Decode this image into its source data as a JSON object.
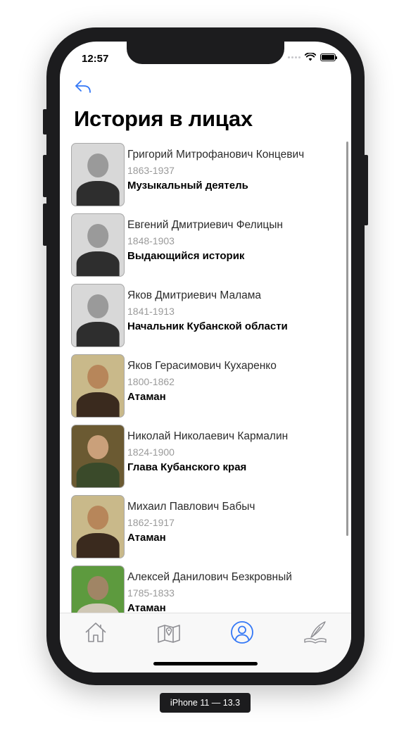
{
  "status_bar": {
    "time": "12:57"
  },
  "header": {
    "title": "История в лицах",
    "back_icon": "back-arrow-icon"
  },
  "colors": {
    "accent": "#3478f6",
    "tab_inactive": "#8e8e93"
  },
  "people": [
    {
      "name": "Григорий Митрофанович Концевич",
      "years": "1863-1937",
      "role": "Музыкальный деятель",
      "photo_tone": "bw"
    },
    {
      "name": "Евгений Дмитриевич Фелицын",
      "years": "1848-1903",
      "role": "Выдающийся историк",
      "photo_tone": "bw"
    },
    {
      "name": "Яков Дмитриевич Малама",
      "years": "1841-1913",
      "role": "Начальник Кубанской области",
      "photo_tone": "bw"
    },
    {
      "name": "Яков Герасимович Кухаренко",
      "years": "1800-1862",
      "role": "Атаман",
      "photo_tone": "oval-color"
    },
    {
      "name": "Николай Николаевич Кармалин",
      "years": "1824-1900",
      "role": "Глава Кубанского края",
      "photo_tone": "color"
    },
    {
      "name": "Михаил Павлович Бабыч",
      "years": "1862-1917",
      "role": "Атаман",
      "photo_tone": "oval-color"
    },
    {
      "name": "Алексей Данилович Безкровный",
      "years": "1785-1833",
      "role": "Атаман",
      "photo_tone": "monument"
    }
  ],
  "tabbar": {
    "tabs": [
      {
        "icon": "home-icon",
        "active": false
      },
      {
        "icon": "map-pin-icon",
        "active": false
      },
      {
        "icon": "person-circle-icon",
        "active": true
      },
      {
        "icon": "quill-book-icon",
        "active": false
      }
    ]
  },
  "device_caption": "iPhone 11 — 13.3"
}
